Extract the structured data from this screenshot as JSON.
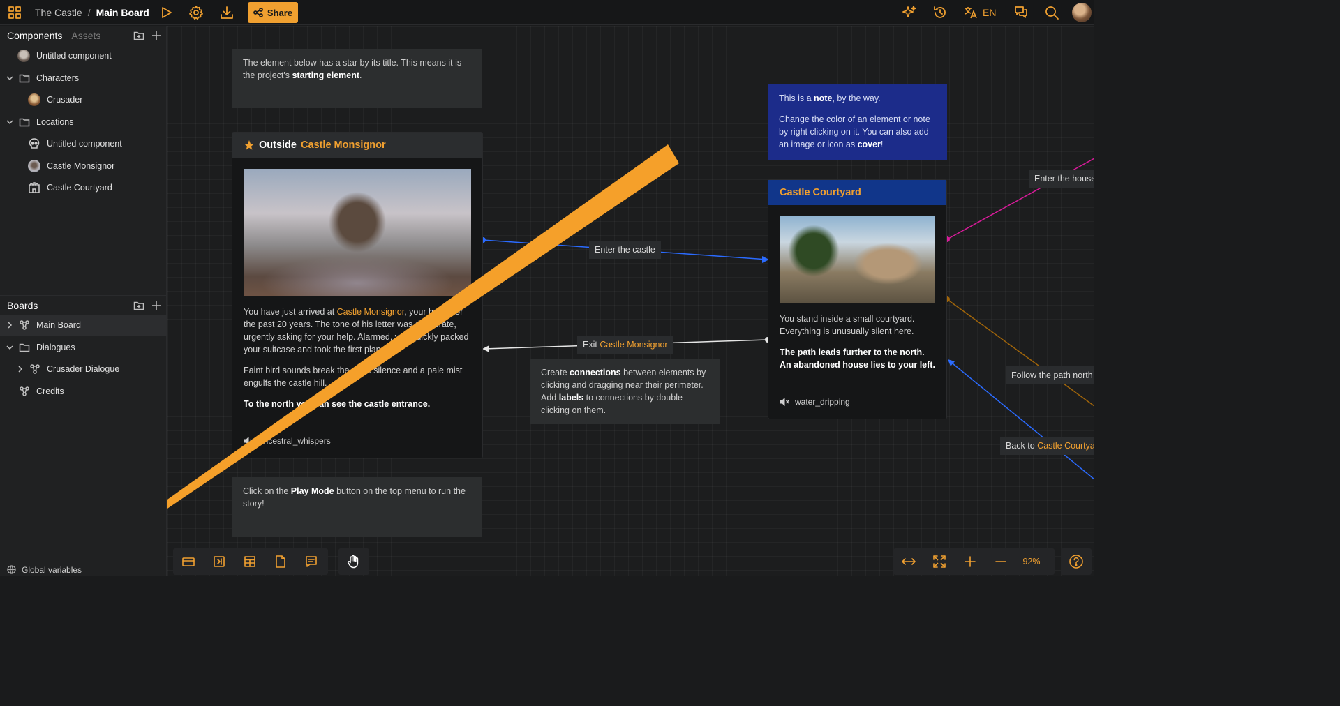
{
  "topbar": {
    "project": "The Castle",
    "separator": "/",
    "board": "Main Board",
    "share_label": "Share",
    "language": "EN"
  },
  "sidebar": {
    "components_tab": "Components",
    "assets_tab": "Assets",
    "components": [
      {
        "label": "Untitled component"
      },
      {
        "label": "Characters"
      },
      {
        "label": "Crusader"
      },
      {
        "label": "Locations"
      },
      {
        "label": "Untitled component"
      },
      {
        "label": "Castle Monsignor"
      },
      {
        "label": "Castle Courtyard"
      }
    ],
    "boards_title": "Boards",
    "boards": [
      {
        "label": "Main Board"
      },
      {
        "label": "Dialogues"
      },
      {
        "label": "Crusader Dialogue"
      },
      {
        "label": "Credits"
      }
    ],
    "global_variables": "Global variables"
  },
  "canvas": {
    "note_start": {
      "t1": "The element below has a star by its title. This means it is the project's ",
      "b1": "starting element",
      "t2": "."
    },
    "note_blue": {
      "t1": "This is a ",
      "b1": "note",
      "t2": ", by the way.",
      "t3": "Change the color of an element or note by right clicking on it. You can also add an image or icon as ",
      "b2": "cover",
      "t4": "!"
    },
    "node_outside": {
      "title_prefix": "Outside",
      "title_link": "Castle Monsignor",
      "p1_a": "You have just arrived at ",
      "p1_link": "Castle Monsignor",
      "p1_b": ", your home for the past 20 years. The tone of his letter was desperate, urgently asking for your help. Alarmed, you quickly packed your suitcase and took the first plane.",
      "p2": "Faint bird sounds break the eerie silence and a pale mist engulfs the castle hill.",
      "p3": "To the north you can see the castle entrance.",
      "audio": "ancestral_whispers"
    },
    "node_courtyard": {
      "title": "Castle Courtyard",
      "p1": "You stand inside a small courtyard. Everything is unusually silent here.",
      "p2": "The path leads further to the north. An abandoned house lies to your left.",
      "audio": "water_dripping"
    },
    "note_connections": {
      "t1": "Create ",
      "b1": "connections",
      "t2": " between elements by clicking and dragging near their perimeter. Add ",
      "b2": "labels",
      "t3": " to connections by double clicking on them."
    },
    "note_play": {
      "t1": "Click on the ",
      "b1": "Play Mode",
      "t2": " button on the top menu to run the story!"
    },
    "labels": {
      "enter_castle": "Enter the castle",
      "exit_prefix": "Exit",
      "exit_link": "Castle Monsignor",
      "enter_house": "Enter the house",
      "follow_path": "Follow the path north",
      "back_prefix": "Back to",
      "back_link": "Castle Courtyard"
    }
  },
  "zoom": {
    "level": "92%"
  },
  "colors": {
    "accent": "#f0a030",
    "note_blue": "#1c2c8a",
    "node_header_blue": "#11368a",
    "connection_blue": "#2b6bff",
    "connection_magenta": "#d81b9a",
    "connection_brown": "#a0650a"
  }
}
